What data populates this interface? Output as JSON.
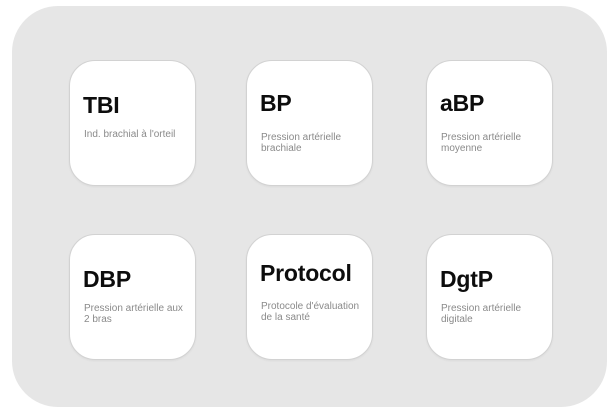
{
  "colors": {
    "panel_background": "#e6e6e6",
    "tile_background": "#ffffff",
    "title_text": "#0d0d0d",
    "description_text": "#8a8a8a"
  },
  "tiles": [
    {
      "title": "TBI",
      "description": "Ind. brachial à l'orteil"
    },
    {
      "title": "BP",
      "description": "Pression artérielle brachiale"
    },
    {
      "title": "aBP",
      "description": "Pression artérielle moyenne"
    },
    {
      "title": "DBP",
      "description": "Pression artérielle aux 2 bras"
    },
    {
      "title": "Protocol",
      "description": "Protocole d'évaluation de la santé"
    },
    {
      "title": "DgtP",
      "description": "Pression artérielle digitale"
    }
  ]
}
